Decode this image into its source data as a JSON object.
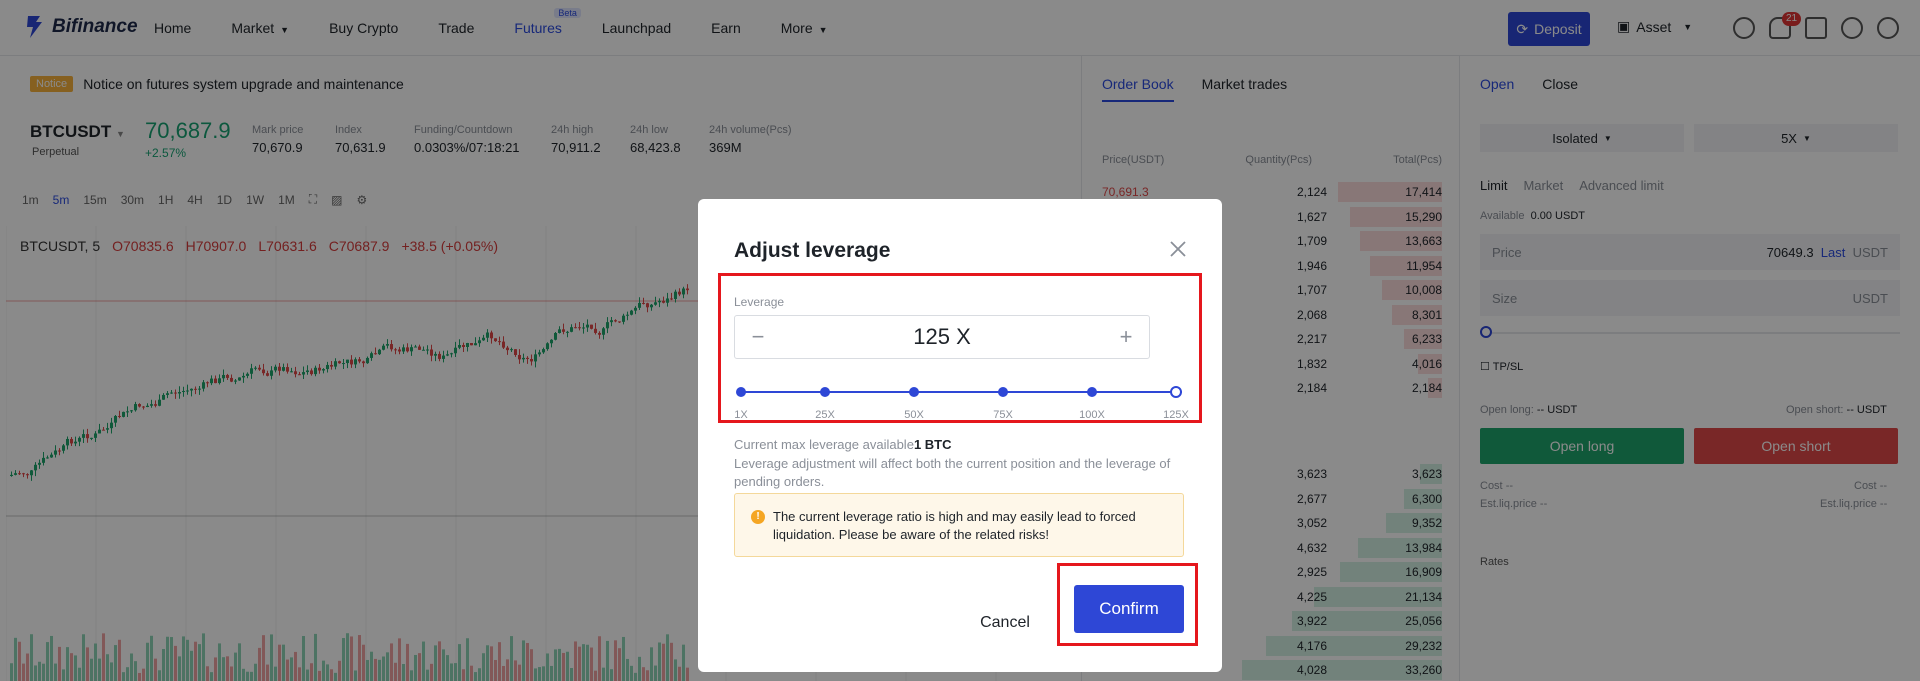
{
  "nav": {
    "logo": "Bifinance",
    "items": [
      "Home",
      "Market",
      "Buy Crypto",
      "Trade",
      "Futures",
      "Launchpad",
      "Earn",
      "More"
    ],
    "beta": "Beta",
    "deposit": "Deposit",
    "asset": "Asset",
    "bell_count": "21"
  },
  "notice": {
    "tag": "Notice",
    "text": "Notice on futures system upgrade and maintenance"
  },
  "ticker": {
    "symbol": "BTCUSDT",
    "perpetual": "Perpetual",
    "last": "70,687.9",
    "change": "+2.57%",
    "stats": [
      {
        "label": "Mark price",
        "value": "70,670.9"
      },
      {
        "label": "Index",
        "value": "70,631.9"
      },
      {
        "label": "Funding/Countdown",
        "value": "0.0303%/07:18:21"
      },
      {
        "label": "24h high",
        "value": "70,911.2"
      },
      {
        "label": "24h low",
        "value": "68,423.8"
      },
      {
        "label": "24h volume(Pcs)",
        "value": "369M"
      }
    ]
  },
  "intervals": [
    "1m",
    "5m",
    "15m",
    "30m",
    "1H",
    "4H",
    "1D",
    "1W",
    "1M"
  ],
  "chart_legend": {
    "pair": "BTCUSDT, 5",
    "o": "O70835.6",
    "h": "H70907.0",
    "l": "L70631.6",
    "c": "C70687.9",
    "chg": "+38.5 (+0.05%)"
  },
  "orderbook": {
    "tabs": [
      "Order Book",
      "Market trades"
    ],
    "headers": [
      "Price(USDT)",
      "Quantity(Pcs)",
      "Total(Pcs)"
    ],
    "asks": [
      {
        "p": "70,691.3",
        "q": "2,124",
        "t": "17,414",
        "depth": 0.52
      },
      {
        "p": "",
        "q": "1,627",
        "t": "15,290",
        "depth": 0.46
      },
      {
        "p": "",
        "q": "1,709",
        "t": "13,663",
        "depth": 0.41
      },
      {
        "p": "",
        "q": "1,946",
        "t": "11,954",
        "depth": 0.36
      },
      {
        "p": "",
        "q": "1,707",
        "t": "10,008",
        "depth": 0.3
      },
      {
        "p": "",
        "q": "2,068",
        "t": "8,301",
        "depth": 0.25
      },
      {
        "p": "",
        "q": "2,217",
        "t": "6,233",
        "depth": 0.19
      },
      {
        "p": "",
        "q": "1,832",
        "t": "4,016",
        "depth": 0.12
      },
      {
        "p": "",
        "q": "2,184",
        "t": "2,184",
        "depth": 0.07
      }
    ],
    "bids": [
      {
        "p": "",
        "q": "3,623",
        "t": "3,623",
        "depth": 0.11
      },
      {
        "p": "",
        "q": "2,677",
        "t": "6,300",
        "depth": 0.19
      },
      {
        "p": "",
        "q": "3,052",
        "t": "9,352",
        "depth": 0.28
      },
      {
        "p": "",
        "q": "4,632",
        "t": "13,984",
        "depth": 0.42
      },
      {
        "p": "",
        "q": "2,925",
        "t": "16,909",
        "depth": 0.51
      },
      {
        "p": "",
        "q": "4,225",
        "t": "21,134",
        "depth": 0.64
      },
      {
        "p": "",
        "q": "3,922",
        "t": "25,056",
        "depth": 0.75
      },
      {
        "p": "",
        "q": "4,176",
        "t": "29,232",
        "depth": 0.88
      },
      {
        "p": "",
        "q": "4,028",
        "t": "33,260",
        "depth": 1.0
      }
    ]
  },
  "trade": {
    "tabs": [
      "Open",
      "Close"
    ],
    "margin_mode": "Isolated",
    "leverage": "5X",
    "order_types": [
      "Limit",
      "Market",
      "Advanced limit"
    ],
    "available_label": "Available",
    "available_value": "0.00 USDT",
    "price_label": "Price",
    "price_value": "70649.3",
    "price_last": "Last",
    "price_unit": "USDT",
    "size_label": "Size",
    "size_unit": "USDT",
    "tpsl": "TP/SL",
    "open_long_label": "Open long:",
    "open_long_value": "-- USDT",
    "open_short_label": "Open short:",
    "open_short_value": "-- USDT",
    "btn_long": "Open long",
    "btn_short": "Open short",
    "cost": "Cost",
    "cost_value": "--",
    "est_liq": "Est.liq.price",
    "rates": "Rates"
  },
  "modal": {
    "title": "Adjust leverage",
    "leverage_label": "Leverage",
    "value": "125 X",
    "ticks": [
      "1X",
      "25X",
      "50X",
      "75X",
      "100X",
      "125X"
    ],
    "max_text": "Current max leverage available",
    "max_value": "1 BTC",
    "note": "Leverage adjustment will affect both the current position and the leverage of pending orders.",
    "warning": "The current leverage ratio is high and may easily lead to forced liquidation. Please be aware of the related risks!",
    "cancel": "Cancel",
    "confirm": "Confirm"
  }
}
